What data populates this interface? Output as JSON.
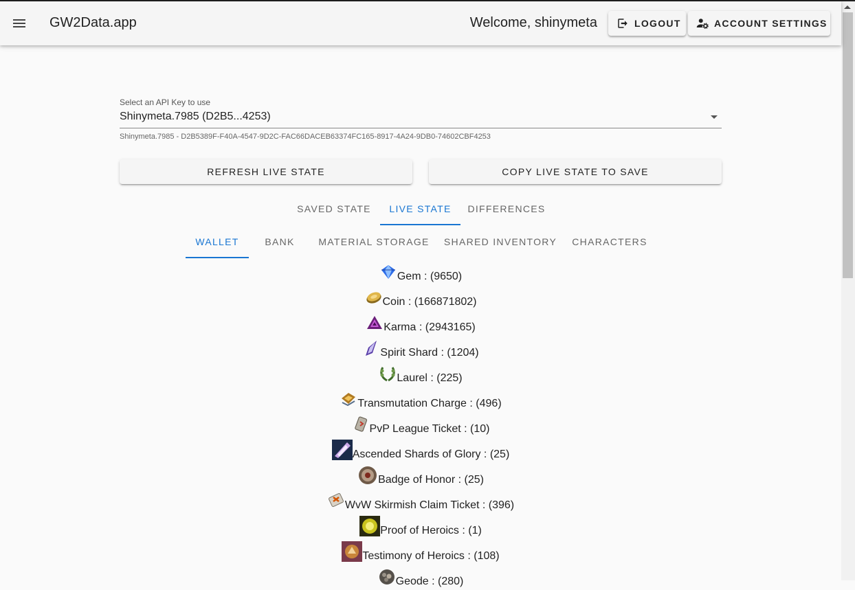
{
  "header": {
    "app_title": "GW2Data.app",
    "welcome": "Welcome, shinymeta",
    "logout_label": "LOGOUT",
    "account_settings_label": "ACCOUNT SETTINGS"
  },
  "api_key": {
    "label": "Select an API Key to use",
    "selected": "Shinymeta.7985 (D2B5...4253)",
    "hint": "Shinymeta.7985 - D2B5389F-F40A-4547-9D2C-FAC66DACEB63374FC165-8917-4A24-9DB0-74602CBF4253"
  },
  "actions": {
    "refresh_label": "REFRESH LIVE STATE",
    "copy_label": "COPY LIVE STATE TO SAVE"
  },
  "state_tabs": [
    {
      "label": "SAVED STATE",
      "active": false
    },
    {
      "label": "LIVE STATE",
      "active": true
    },
    {
      "label": "DIFFERENCES",
      "active": false
    }
  ],
  "section_tabs": [
    {
      "label": "WALLET",
      "active": true
    },
    {
      "label": "BANK",
      "active": false
    },
    {
      "label": "MATERIAL STORAGE",
      "active": false
    },
    {
      "label": "SHARED INVENTORY",
      "active": false
    },
    {
      "label": "CHARACTERS",
      "active": false
    }
  ],
  "wallet": [
    {
      "name": "Gem",
      "amount": "9650",
      "icon": "gem-icon"
    },
    {
      "name": "Coin",
      "amount": "166871802",
      "icon": "coin-icon"
    },
    {
      "name": "Karma",
      "amount": "2943165",
      "icon": "karma-icon"
    },
    {
      "name": "Spirit Shard",
      "amount": "1204",
      "icon": "spirit-shard-icon"
    },
    {
      "name": "Laurel",
      "amount": "225",
      "icon": "laurel-icon"
    },
    {
      "name": "Transmutation Charge",
      "amount": "496",
      "icon": "transmutation-charge-icon"
    },
    {
      "name": "PvP League Ticket",
      "amount": "10",
      "icon": "pvp-league-ticket-icon"
    },
    {
      "name": "Ascended Shards of Glory",
      "amount": "25",
      "icon": "ascended-shards-icon"
    },
    {
      "name": "Badge of Honor",
      "amount": "25",
      "icon": "badge-of-honor-icon"
    },
    {
      "name": "WvW Skirmish Claim Ticket",
      "amount": "396",
      "icon": "skirmish-ticket-icon"
    },
    {
      "name": "Proof of Heroics",
      "amount": "1",
      "icon": "proof-of-heroics-icon"
    },
    {
      "name": "Testimony of Heroics",
      "amount": "108",
      "icon": "testimony-of-heroics-icon"
    },
    {
      "name": "Geode",
      "amount": "280",
      "icon": "geode-icon"
    }
  ],
  "colors": {
    "accent": "#1976d2",
    "appbar": "#f5f5f5",
    "background": "#fafafa"
  }
}
